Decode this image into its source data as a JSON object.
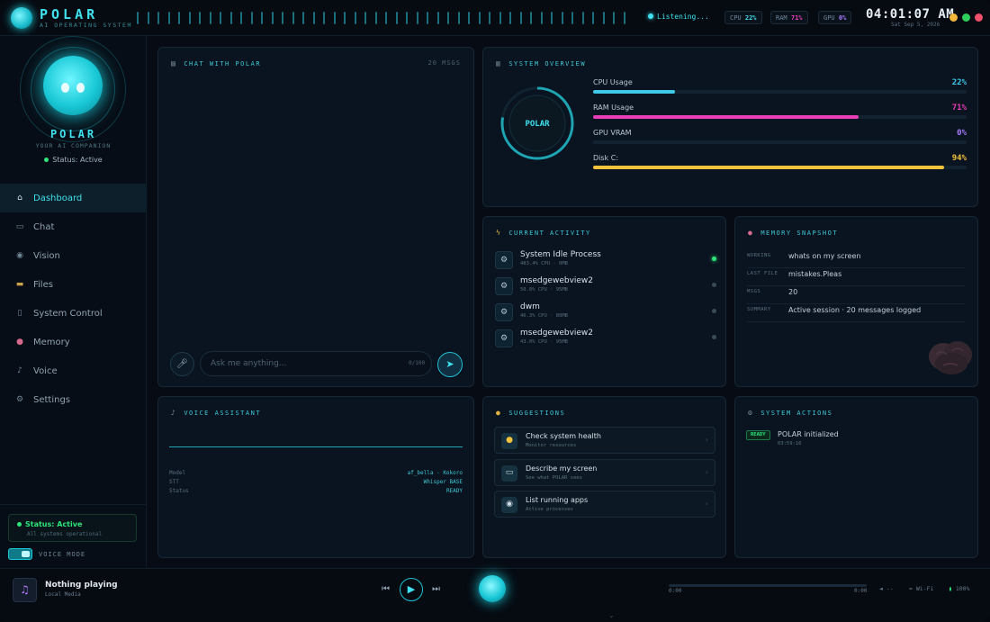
{
  "topbar": {
    "brand": "POLAR",
    "subtitle": "AI OPERATING SYSTEM",
    "listening": "Listening...",
    "cpu_label": "CPU",
    "cpu_value": "22%",
    "ram_label": "RAM",
    "ram_value": "71%",
    "gpu_label": "GPU",
    "gpu_value": "0%",
    "time": "04:01:07 AM",
    "date": "Sat Sep 5, 2026",
    "window_dots": [
      "#f3b73b",
      "#2ecf5a",
      "#f0506b"
    ]
  },
  "sidebar": {
    "name": "POLAR",
    "tagline": "YOUR AI COMPANION",
    "status": "Status: Active",
    "items": [
      {
        "label": "Dashboard",
        "icon": "home-icon",
        "active": true
      },
      {
        "label": "Chat",
        "icon": "chat-icon"
      },
      {
        "label": "Vision",
        "icon": "eye-icon"
      },
      {
        "label": "Files",
        "icon": "folder-icon"
      },
      {
        "label": "System Control",
        "icon": "server-icon"
      },
      {
        "label": "Memory",
        "icon": "brain-icon"
      },
      {
        "label": "Voice",
        "icon": "mic-icon"
      },
      {
        "label": "Settings",
        "icon": "gear-icon"
      }
    ],
    "status_box_title": "Status: Active",
    "status_box_sub": "All systems operational",
    "voice_mode": "VOICE MODE"
  },
  "chat": {
    "title": "CHAT WITH POLAR",
    "count": "20 MSGS",
    "placeholder": "Ask me anything...",
    "char_count": "0/100"
  },
  "overview": {
    "title": "SYSTEM OVERVIEW",
    "gauge_label": "POLAR",
    "metrics": [
      {
        "label": "CPU Usage",
        "value": "22%",
        "fraction": 0.22,
        "color": "#3fc9e8"
      },
      {
        "label": "RAM Usage",
        "value": "71%",
        "fraction": 0.71,
        "color": "#e83fb8"
      },
      {
        "label": "GPU VRAM",
        "value": "0%",
        "fraction": 0.0,
        "color": "#a77cff"
      },
      {
        "label": "Disk C:",
        "value": "94%",
        "fraction": 0.94,
        "color": "#f3c33b"
      }
    ]
  },
  "activity": {
    "title": "CURRENT ACTIVITY",
    "rows": [
      {
        "name": "System Idle Process",
        "sub": "483.4% CPU · 0MB",
        "active": true
      },
      {
        "name": "msedgewebview2",
        "sub": "50.0% CPU · 95MB",
        "active": false
      },
      {
        "name": "dwm",
        "sub": "46.3% CPU · 80MB",
        "active": false
      },
      {
        "name": "msedgewebview2",
        "sub": "43.0% CPU · 95MB",
        "active": false
      }
    ]
  },
  "memory": {
    "title": "MEMORY SNAPSHOT",
    "rows": [
      {
        "key": "WORKING",
        "value": "whats on my screen"
      },
      {
        "key": "LAST FILE",
        "value": "mistakes.Pleas"
      },
      {
        "key": "MSGS",
        "value": "20"
      },
      {
        "key": "SUMMARY",
        "value": "Active session · 20 messages logged"
      }
    ]
  },
  "voice": {
    "title": "VOICE ASSISTANT",
    "rows": [
      {
        "key": "Model",
        "value": "af_bella · Kokoro"
      },
      {
        "key": "STT",
        "value": "Whisper BASE"
      },
      {
        "key": "Status",
        "value": "READY"
      }
    ]
  },
  "suggestions": {
    "title": "SUGGESTIONS",
    "items": [
      {
        "title": "Check system health",
        "sub": "Monitor resources",
        "icon": "lightbulb-icon"
      },
      {
        "title": "Describe my screen",
        "sub": "See what POLAR sees",
        "icon": "monitor-icon"
      },
      {
        "title": "List running apps",
        "sub": "Active processes",
        "icon": "eye-icon"
      }
    ]
  },
  "actions": {
    "title": "SYSTEM ACTIONS",
    "badge": "READY",
    "text": "POLAR initialized",
    "time": "03:59:16"
  },
  "player": {
    "title": "Nothing playing",
    "subtitle": "Local Media",
    "time_start": "0:00",
    "time_end": "0:00",
    "volume": "--",
    "wifi": "Wi-Fi",
    "battery": "100%"
  }
}
